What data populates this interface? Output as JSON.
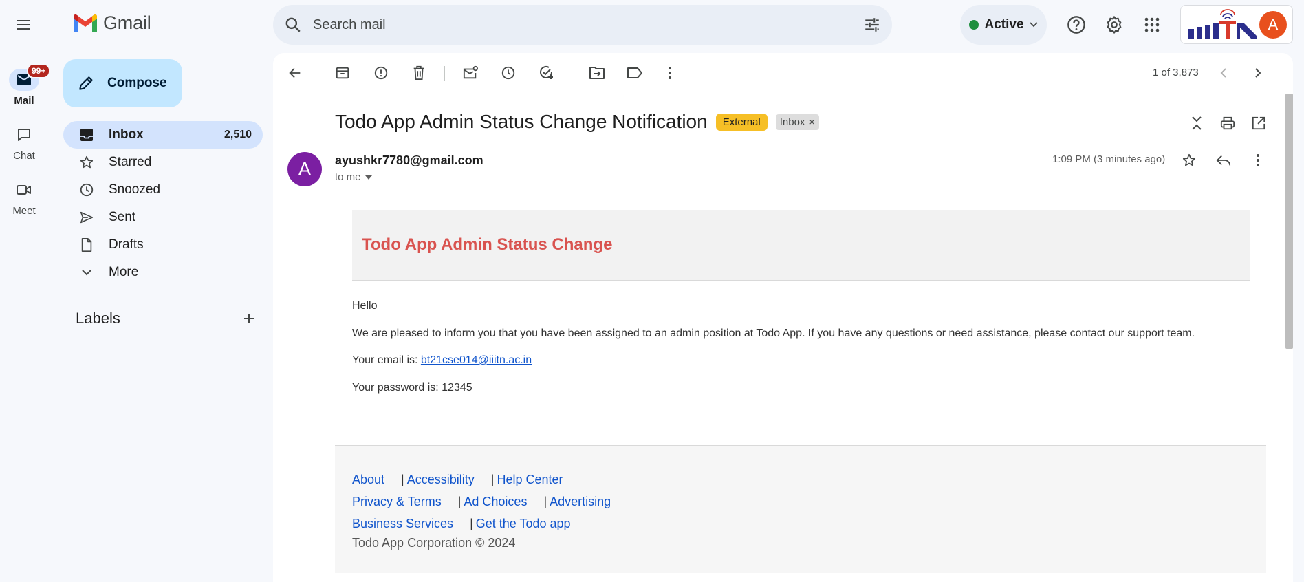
{
  "app": {
    "name": "Gmail"
  },
  "rail": {
    "items": [
      {
        "label": "Mail",
        "badge": "99+",
        "icon": "mail-icon"
      },
      {
        "label": "Chat",
        "icon": "chat-icon"
      },
      {
        "label": "Meet",
        "icon": "video-icon"
      }
    ]
  },
  "search": {
    "placeholder": "Search mail"
  },
  "status": {
    "label": "Active",
    "color": "#1e8e3e"
  },
  "account": {
    "initial": "A",
    "avatar_color": "#e8501d"
  },
  "compose": {
    "label": "Compose"
  },
  "nav": {
    "items": [
      {
        "label": "Inbox",
        "count": "2,510",
        "icon": "inbox-icon",
        "active": true
      },
      {
        "label": "Starred",
        "icon": "star-icon"
      },
      {
        "label": "Snoozed",
        "icon": "clock-icon"
      },
      {
        "label": "Sent",
        "icon": "send-icon"
      },
      {
        "label": "Drafts",
        "icon": "draft-icon"
      },
      {
        "label": "More",
        "icon": "chevron-down-icon"
      }
    ]
  },
  "labels": {
    "heading": "Labels"
  },
  "pager": {
    "text": "1 of 3,873"
  },
  "email": {
    "subject": "Todo App Admin Status Change Notification",
    "chip_external": "External",
    "chip_inbox": "Inbox",
    "chip_close": "×",
    "sender_initial": "A",
    "sender_avatar_color": "#7b1fa2",
    "sender": "ayushkr7780@gmail.com",
    "to": "to me",
    "time": "1:09 PM (3 minutes ago)",
    "banner_title": "Todo App Admin Status Change",
    "greeting": "Hello",
    "message": "We are pleased to inform you that you have been assigned to an admin position at Todo App. If you have any questions or need assistance, please contact our support team.",
    "email_prefix": "Your email is: ",
    "email_value": "bt21cse014@iiitn.ac.in",
    "password_prefix": "Your password is: ",
    "password_value": "12345"
  },
  "footer": {
    "links_row1": [
      "About",
      "Accessibility",
      "Help Center"
    ],
    "links_row2": [
      "Privacy & Terms",
      "Ad Choices",
      "Advertising"
    ],
    "links_row3": [
      "Business Services",
      "Get the Todo app"
    ],
    "separator": "|",
    "copyright": "Todo App Corporation © 2024"
  }
}
